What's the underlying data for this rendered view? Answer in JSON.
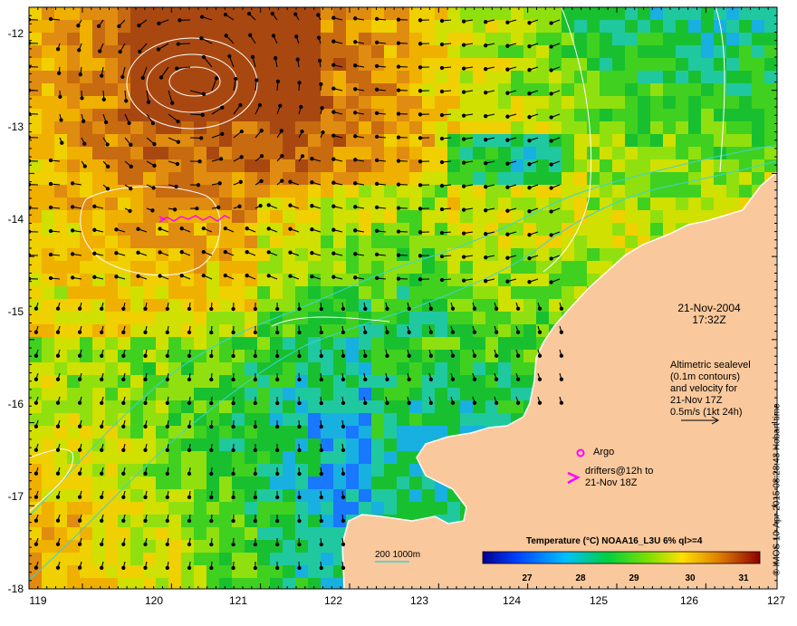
{
  "map": {
    "date": "21-Nov-2004",
    "time": "17:32Z",
    "altimetry_text": [
      "Altimetric sealevel",
      "(0.1m contours)",
      "and velocity for",
      "21-Nov 17Z",
      "0.5m/s (1kt 24h)"
    ],
    "argo_label": "Argo",
    "drifter_label": [
      "drifters@12h to",
      "21-Nov 18Z"
    ],
    "isobath_label": "200  1000m",
    "credit": "© IMOS 10-Apr-2015 08:28:43 Hobart time",
    "colorbar": {
      "title": "Temperature (°C) NOAA16_L3U 6% ql>=4",
      "ticks": [
        "27",
        "28",
        "29",
        "30",
        "31"
      ],
      "range": [
        26.3,
        31.8
      ]
    },
    "lat_ticks": [
      "-12",
      "-13",
      "-14",
      "-15",
      "-16",
      "-17",
      "-18"
    ],
    "lon_ticks": [
      "119",
      "120",
      "121",
      "122",
      "123",
      "124",
      "125",
      "126",
      "127"
    ],
    "colors": {
      "land": "#f9c89c",
      "coast": "#ffffff",
      "contour": "#ffffff",
      "isobath": "#3ad4d8",
      "argo": "#ff00ff",
      "drifter": "#ff00ff"
    }
  }
}
